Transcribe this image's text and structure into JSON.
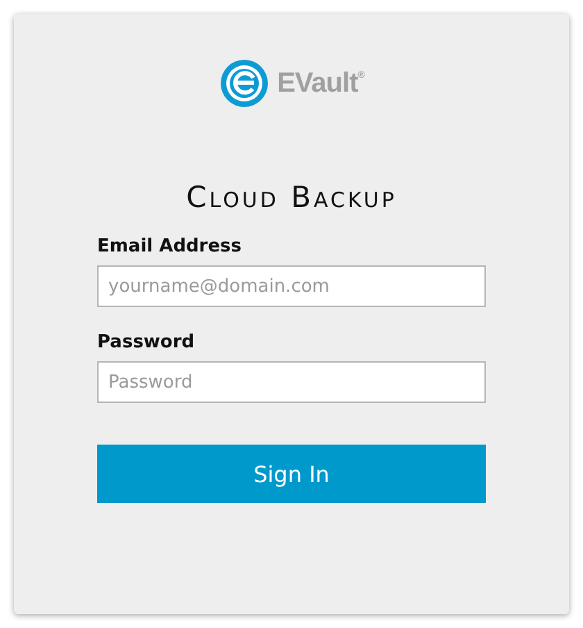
{
  "logo": {
    "text": "EVault$^{®}$"
  },
  "title": "Cloud Backup",
  "fields": [
    {
      "label": "Email Address",
      "placeholder": "yourname@domain.com"
    },
    {
      "label": "Password",
      "placeholder": "Password"
    }
  ],
  "button": "Sign In"
}
